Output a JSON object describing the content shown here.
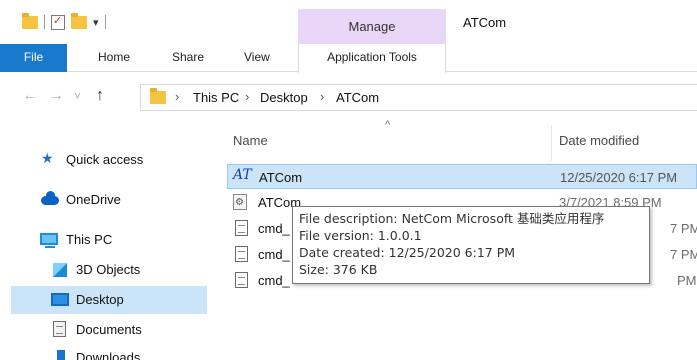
{
  "window": {
    "title": "ATCom",
    "contextual_tab_group": "Manage",
    "qat_dropdown": "▾"
  },
  "ribbon": {
    "tabs": [
      "File",
      "Home",
      "Share",
      "View",
      "Application Tools"
    ]
  },
  "navigation": {
    "back": "←",
    "forward": "→",
    "recent": "˅",
    "up": "↑"
  },
  "address_bar": {
    "breadcrumbs": [
      "This PC",
      "Desktop",
      "ATCom"
    ],
    "separator": "›"
  },
  "nav_pane": {
    "items": [
      {
        "label": "Quick access",
        "icon": "star-icon"
      },
      {
        "label": "OneDrive",
        "icon": "cloud-icon"
      },
      {
        "label": "This PC",
        "icon": "computer-icon"
      },
      {
        "label": "3D Objects",
        "icon": "cube-icon"
      },
      {
        "label": "Desktop",
        "icon": "desktop-icon",
        "selected": true
      },
      {
        "label": "Documents",
        "icon": "documents-icon"
      },
      {
        "label": "Downloads",
        "icon": "download-icon"
      }
    ]
  },
  "file_list": {
    "sort_indicator": "^",
    "columns": {
      "name": "Name",
      "date_modified": "Date modified"
    },
    "rows": [
      {
        "name": "ATCom",
        "date": "12/25/2020 6:17 PM",
        "icon": "atcom-app-icon",
        "selected": true
      },
      {
        "name": "ATCom",
        "date": "3/7/2021 8:59 PM",
        "icon": "config-file-icon"
      },
      {
        "name": "cmd_",
        "date": "7 PM",
        "icon": "text-file-icon"
      },
      {
        "name": "cmd_",
        "date": "7 PM",
        "icon": "text-file-icon"
      },
      {
        "name": "cmd_",
        "date": "PM",
        "icon": "text-file-icon"
      }
    ]
  },
  "tooltip": {
    "lines": [
      "File description: NetCom Microsoft 基础类应用程序",
      "File version: 1.0.0.1",
      "Date created: 12/25/2020 6:17 PM",
      "Size: 376 KB"
    ]
  },
  "colors": {
    "file_tab": "#1979ca",
    "manage_tab": "#e9d7f7",
    "selection": "#cce4f7"
  }
}
